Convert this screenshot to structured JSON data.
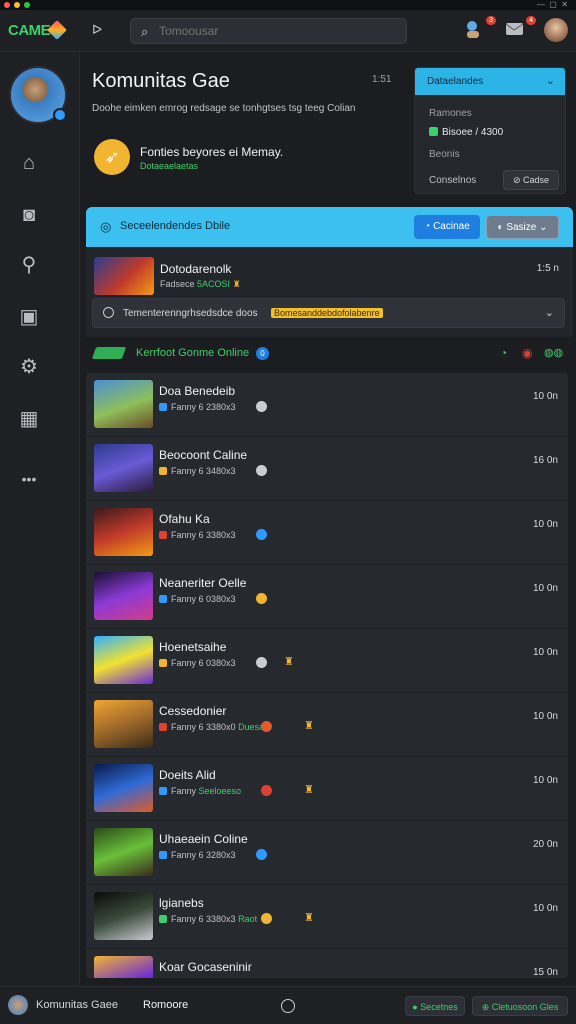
{
  "app": {
    "logo_text": "CAME",
    "brand_color": "#3fcf6a",
    "accent_color": "#3cc0ef"
  },
  "topbar": {
    "search_placeholder": "Tomoousar",
    "menu_icon": "chevron-right-icon",
    "notifications": [
      {
        "icon": "friends-icon",
        "count": "3"
      },
      {
        "icon": "message-icon",
        "count": "4"
      }
    ]
  },
  "sidebar": {
    "items": [
      {
        "icon": "home-icon"
      },
      {
        "icon": "chat-icon"
      },
      {
        "icon": "search-icon"
      },
      {
        "icon": "library-icon"
      },
      {
        "icon": "settings-icon"
      },
      {
        "icon": "grid-icon"
      },
      {
        "icon": "more-icon"
      }
    ]
  },
  "header": {
    "title": "Komunitas Gae",
    "number": "1:51",
    "description": "Doohe eimken emrog redsage se tonhgtses tsg teeg Colian",
    "feature_title": "Fonties beyores ei Memay.",
    "feature_sub": "Dotaeaelaetas"
  },
  "right_panel": {
    "dropdown": "Dataelandes",
    "line1": "Ramones",
    "line2": "Bisoee / 4300",
    "line3": "Beonis",
    "line4": "Conselnos",
    "button": "Cadse"
  },
  "bluebar": {
    "text": "Seceelendendes Dbile",
    "button1": "Cacinae",
    "button2": "Sasize"
  },
  "featured": {
    "title": "Dotodarenolk",
    "sub_prefix": "Fadsece",
    "sub_highlight": "5ACOSI",
    "number": "1:5 n",
    "bar_text": "Tementerenngrhsedsdce doos",
    "bar_highlight": "Bomesanddebdofolabenre"
  },
  "section": {
    "title": "Kerrfoot Gonme Online",
    "badge": "0"
  },
  "games": [
    {
      "title": "Doa Benedeib",
      "sub": "Fanny 6 2380x3",
      "time": "10 0n",
      "badge": "#c9ccd2",
      "icon": "#2f9bff"
    },
    {
      "title": "Beocoont Caline",
      "sub": "Fanny 6 3480x3",
      "time": "16 0n",
      "badge": "#c9ccd2",
      "icon": "#f2b531"
    },
    {
      "title": "Ofahu Ka",
      "sub": "Fanny 6 3380x3",
      "time": "10 0n",
      "badge": "#2f9bff",
      "icon": "#e0402f"
    },
    {
      "title": "Neaneriter Oelle",
      "sub": "Fanny 6 0380x3",
      "time": "10 0n",
      "badge": "#f2b531",
      "icon": "#2f9bff"
    },
    {
      "title": "Hoenetsaihe",
      "sub": "Fanny 6 0380x3",
      "time": "10 0n",
      "badge": "#c9ccd2",
      "icon": "#f2b531",
      "tag": "true"
    },
    {
      "title": "Cessedonier",
      "sub": "Fanny 6 3380x0",
      "time": "10 0n",
      "badge": "#e05a2a",
      "icon": "#e0402f",
      "green": "Duesa",
      "tag": "true"
    },
    {
      "title": "Doeits Alid",
      "sub": "Fanny",
      "time": "10 0n",
      "badge": "#e0402f",
      "icon": "#2f9bff",
      "green": "Seeloeeso",
      "tag": "true"
    },
    {
      "title": "Uhaeaein Coline",
      "sub": "Fanny 6 3280x3",
      "time": "20 0n",
      "badge": "#2f9bff",
      "icon": "#2f9bff"
    },
    {
      "title": "lgianebs",
      "sub": "Fanny 6 3380x3",
      "time": "10 0n",
      "badge": "#f2b531",
      "icon": "#3fcf6a",
      "green": "Raot",
      "tag": "true"
    },
    {
      "title": "Koar Gocaseninir",
      "sub": "",
      "time": "15 0n",
      "badge": "",
      "icon": "#f2b531"
    }
  ],
  "bottom": {
    "name": "Komunitas Gaee",
    "tab": "Romoore",
    "btn1": "Secetnes",
    "btn2": "Cletuosoon Gles"
  }
}
